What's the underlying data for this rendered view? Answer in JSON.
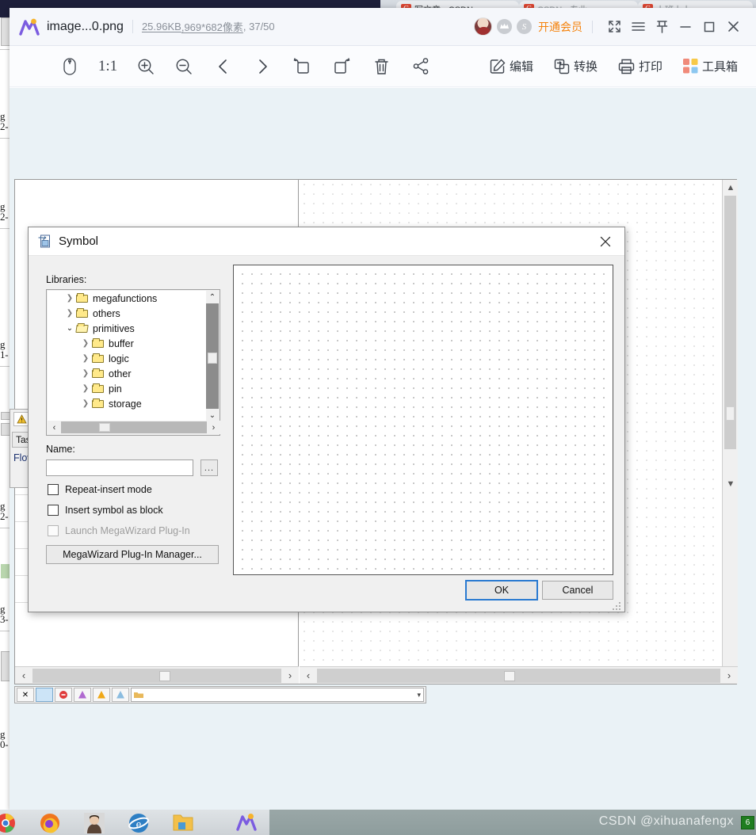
{
  "browser": {
    "tabs": [
      {
        "favicon": "C",
        "title": "写文章 - CSDN"
      },
      {
        "favicon": "C",
        "title": "CSDN - 专业..."
      },
      {
        "favicon": "C",
        "title": "上班上上..."
      }
    ]
  },
  "viewer": {
    "file_name": "image...0.png",
    "file_size": "25.96KB",
    "dimensions": ",969*682像素",
    "index": ", 37/50",
    "vip_label": "开通会员",
    "window_controls": {
      "fullscreen": "fullscreen-icon",
      "menu": "hamburger-menu-icon",
      "pin": "pin-icon",
      "minimize": "minimize-icon",
      "maximize": "maximize-icon",
      "close": "close-icon"
    },
    "badges": [
      "crown-icon",
      "s-badge-icon"
    ],
    "toolbar": {
      "items": [
        {
          "icon": "mouse-icon",
          "label": ""
        },
        {
          "icon": "actual-size-icon",
          "label": "1:1"
        },
        {
          "icon": "zoom-in-icon",
          "label": ""
        },
        {
          "icon": "zoom-out-icon",
          "label": ""
        },
        {
          "icon": "previous-icon",
          "label": ""
        },
        {
          "icon": "next-icon",
          "label": ""
        },
        {
          "icon": "rotate-left-icon",
          "label": ""
        },
        {
          "icon": "rotate-right-icon",
          "label": ""
        },
        {
          "icon": "delete-icon",
          "label": ""
        },
        {
          "icon": "share-icon",
          "label": ""
        }
      ],
      "actions": [
        {
          "icon": "edit-icon",
          "label": "编辑"
        },
        {
          "icon": "convert-icon",
          "label": "转换"
        },
        {
          "icon": "print-icon",
          "label": "打印"
        },
        {
          "icon": "toolbox-icon",
          "label": "工具箱"
        }
      ]
    }
  },
  "background_window": {
    "left_fragments": [
      "g",
      "2-",
      "g",
      "2-",
      "g",
      "1-",
      "g",
      "2-",
      "g",
      "3-",
      "g",
      "0-"
    ],
    "tasks_label": "Tas",
    "flow_label": "Flow"
  },
  "dialog": {
    "title": "Symbol",
    "close_label": "✕",
    "libraries_label": "Libraries:",
    "tree": [
      {
        "label": "megafunctions",
        "depth": 0,
        "expanded": false
      },
      {
        "label": "others",
        "depth": 0,
        "expanded": false
      },
      {
        "label": "primitives",
        "depth": 0,
        "expanded": true
      },
      {
        "label": "buffer",
        "depth": 1,
        "expanded": false
      },
      {
        "label": "logic",
        "depth": 1,
        "expanded": false
      },
      {
        "label": "other",
        "depth": 1,
        "expanded": false
      },
      {
        "label": "pin",
        "depth": 1,
        "expanded": false
      },
      {
        "label": "storage",
        "depth": 1,
        "expanded": false
      }
    ],
    "name_label": "Name:",
    "name_value": "",
    "browse_label": "...",
    "checkboxes": [
      {
        "label": "Repeat-insert mode",
        "checked": false,
        "disabled": false
      },
      {
        "label": "Insert symbol as block",
        "checked": false,
        "disabled": false
      },
      {
        "label": "Launch MegaWizard Plug-In",
        "checked": false,
        "disabled": true
      }
    ],
    "megawizard_button": "MegaWizard Plug-In Manager...",
    "ok_label": "OK",
    "cancel_label": "Cancel"
  },
  "taskbar": {
    "icons": [
      "chrome-icon",
      "firefox-icon",
      "person-icon",
      "ie-icon",
      "explorer-icon",
      "viewer-icon"
    ],
    "watermark": "CSDN @xihuanafengx",
    "tray_badge": "6"
  },
  "colors": {
    "vip_orange": "#f5820b",
    "focus_blue": "#2a7ad1",
    "folder_yellow": "#ffe98a",
    "viewer_canvas": "#eaf2f6"
  }
}
